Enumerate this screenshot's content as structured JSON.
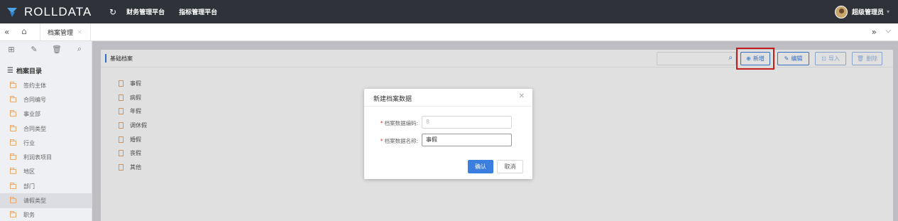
{
  "brand": {
    "name": "ROLLDATA",
    "colors": {
      "accent": "#3a7ee0",
      "topbar": "#2f3238",
      "highlight": "#e02020",
      "folder": "#f0a868"
    }
  },
  "topnav": {
    "refresh_icon": "refresh-icon",
    "links": [
      "财务管理平台",
      "指标管理平台"
    ]
  },
  "user": {
    "name": "超级管理员"
  },
  "tabs": {
    "items": [
      {
        "label": "档案管理"
      }
    ]
  },
  "sidebar": {
    "toolbar_icons": [
      "add-icon",
      "edit-icon",
      "delete-icon",
      "search-icon"
    ],
    "heading": "档案目录",
    "items": [
      {
        "label": "签约主体"
      },
      {
        "label": "合同编号"
      },
      {
        "label": "事业部"
      },
      {
        "label": "合同类型"
      },
      {
        "label": "行业"
      },
      {
        "label": "利润表项目"
      },
      {
        "label": "地区"
      },
      {
        "label": "部门"
      },
      {
        "label": "请假类型",
        "active": true
      },
      {
        "label": "职务"
      }
    ]
  },
  "panel": {
    "title": "基础档案",
    "search": {
      "placeholder": ""
    },
    "buttons": {
      "add": "新增",
      "edit": "编辑",
      "import": "导入",
      "delete": "删除"
    },
    "documents": [
      "事假",
      "病假",
      "年假",
      "调休假",
      "婚假",
      "丧假",
      "其他"
    ]
  },
  "modal": {
    "title": "新建档案数据",
    "fields": {
      "code": {
        "label": "档案数据编码:",
        "value": "8"
      },
      "name": {
        "label": "档案数据名称:",
        "value": "事假"
      }
    },
    "confirm": "确认",
    "cancel": "取消"
  }
}
